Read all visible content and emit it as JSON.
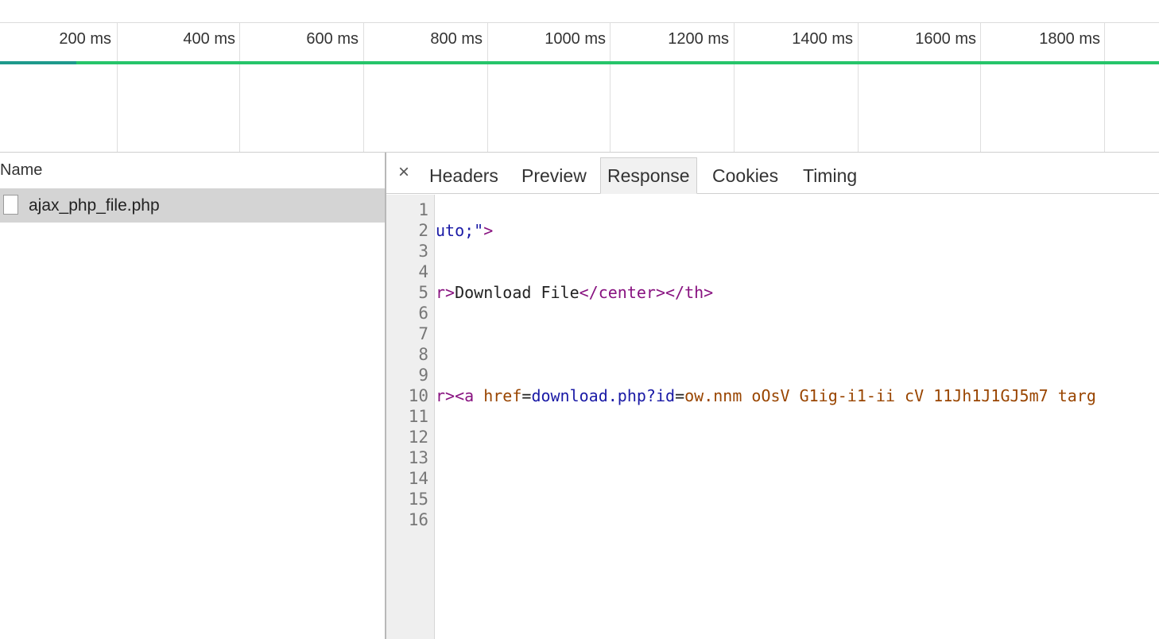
{
  "timeline": {
    "ticks": [
      "200 ms",
      "400 ms",
      "600 ms",
      "800 ms",
      "1000 ms",
      "1200 ms",
      "1400 ms",
      "1600 ms",
      "1800 ms"
    ],
    "colors": {
      "waiting": "#1e9a8c",
      "receiving": "#26c46a"
    }
  },
  "request_list": {
    "header": "Name",
    "rows": [
      {
        "name": "ajax_php_file.php"
      }
    ]
  },
  "detail": {
    "close_glyph": "×",
    "tabs": [
      "Headers",
      "Preview",
      "Response",
      "Cookies",
      "Timing"
    ],
    "active_tab": "Response",
    "line_numbers": [
      "1",
      "2",
      "3",
      "4",
      "5",
      "6",
      "7",
      "8",
      "9",
      "10",
      "11",
      "12",
      "13",
      "14",
      "15",
      "16"
    ],
    "code": {
      "line2": {
        "a": "uto;\"",
        "b": ">"
      },
      "line5": {
        "a": "r>",
        "b": "Download File",
        "c": "</center></th>"
      },
      "line10": {
        "a": "r><a",
        "b": " href",
        "c": "=",
        "d": "download.php?id",
        "e": "=",
        "f": "ow.nnm oOsV G1ig-i1-ii cV 11Jh1J1GJ5m7 targ"
      }
    }
  }
}
